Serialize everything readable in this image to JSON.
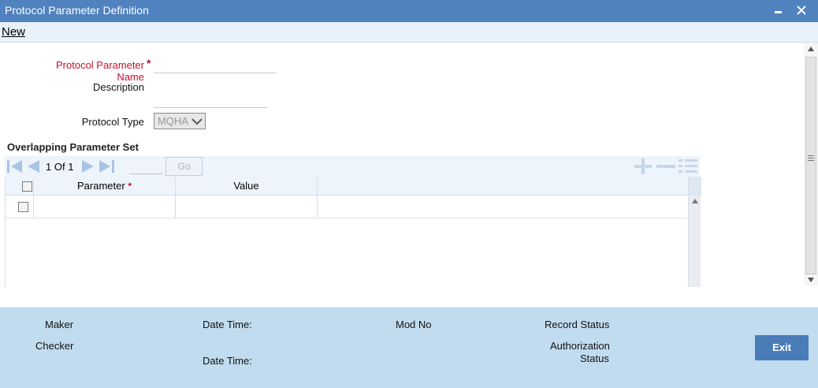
{
  "window": {
    "title": "Protocol Parameter Definition",
    "minimize_icon": "minimize-icon",
    "close_icon": "close-icon"
  },
  "menu": {
    "new_label": "New"
  },
  "form": {
    "protocol_parameter_name": {
      "label": "Protocol Parameter Name",
      "required_mark": "*",
      "value": ""
    },
    "description": {
      "label": "Description",
      "value": ""
    },
    "protocol_type": {
      "label": "Protocol Type",
      "selected": "MQHA"
    }
  },
  "section": {
    "title": "Overlapping Parameter Set"
  },
  "pager": {
    "current": "1",
    "of_label": "Of",
    "total": "1",
    "go_label": "Go",
    "icons": [
      "first-page-icon",
      "previous-page-icon",
      "next-page-icon",
      "last-page-icon",
      "add-row-icon",
      "delete-row-icon",
      "view-rows-icon"
    ]
  },
  "grid": {
    "columns": [
      {
        "label": "Parameter",
        "required_mark": "*"
      },
      {
        "label": "Value",
        "required_mark": ""
      }
    ],
    "rows": [
      {
        "parameter": "",
        "value": ""
      }
    ]
  },
  "footer": {
    "maker": "Maker",
    "checker": "Checker",
    "date_time_1": "Date Time:",
    "date_time_2": "Date Time:",
    "mod_no": "Mod No",
    "record_status": "Record Status",
    "authorization": "Authorization",
    "status": "Status",
    "exit_label": "Exit"
  },
  "colors": {
    "titlebar": "#4f82bf",
    "footer": "#c2dcef",
    "required": "#c8102e",
    "exit_button": "#4a7cb8"
  }
}
